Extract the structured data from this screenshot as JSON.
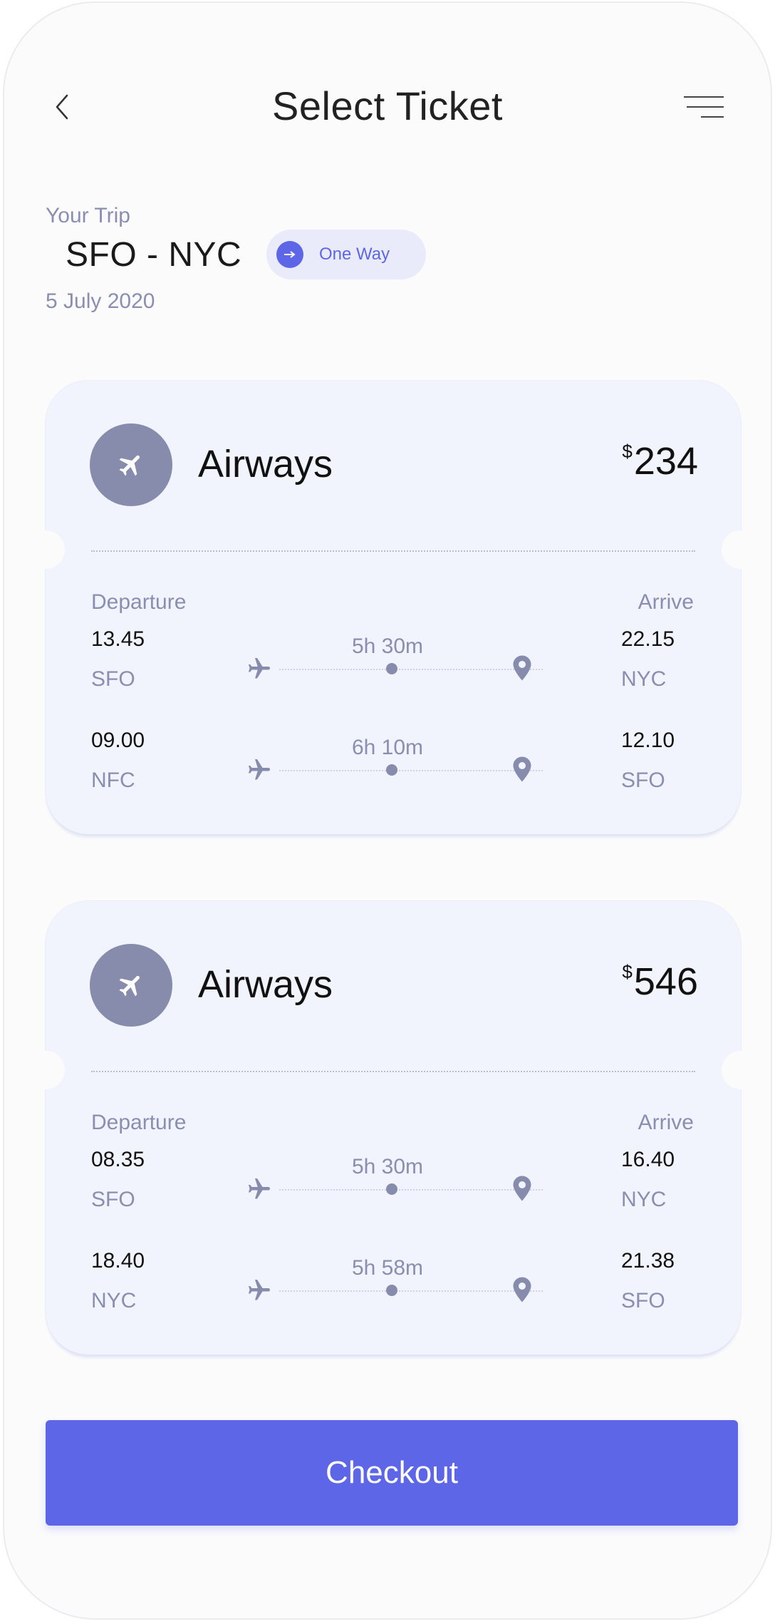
{
  "header": {
    "title": "Select Ticket",
    "back_icon": "chevron-left-icon",
    "menu_icon": "menu-icon"
  },
  "trip": {
    "label": "Your Trip",
    "route": "SFO - NYC",
    "date": "5 July 2020",
    "trip_type": "One Way"
  },
  "tickets": [
    {
      "airline": "Airways",
      "currency": "$",
      "price": "234",
      "departure_label": "Departure",
      "arrive_label": "Arrive",
      "legs": [
        {
          "depart_time": "13.45",
          "depart_code": "SFO",
          "duration": "5h 30m",
          "arrive_time": "22.15",
          "arrive_code": "NYC"
        },
        {
          "depart_time": "09.00",
          "depart_code": "NFC",
          "duration": "6h 10m",
          "arrive_time": "12.10",
          "arrive_code": "SFO"
        }
      ]
    },
    {
      "airline": "Airways",
      "currency": "$",
      "price": "546",
      "departure_label": "Departure",
      "arrive_label": "Arrive",
      "legs": [
        {
          "depart_time": "08.35",
          "depart_code": "SFO",
          "duration": "5h 30m",
          "arrive_time": "16.40",
          "arrive_code": "NYC"
        },
        {
          "depart_time": "18.40",
          "depart_code": "NYC",
          "duration": "5h 58m",
          "arrive_time": "21.38",
          "arrive_code": "SFO"
        }
      ]
    }
  ],
  "checkout": {
    "label": "Checkout"
  },
  "colors": {
    "accent": "#5e66e8",
    "muted_text": "#8a8eb1",
    "card_bg": "#f1f4fc",
    "avatar_bg": "#878cac"
  }
}
